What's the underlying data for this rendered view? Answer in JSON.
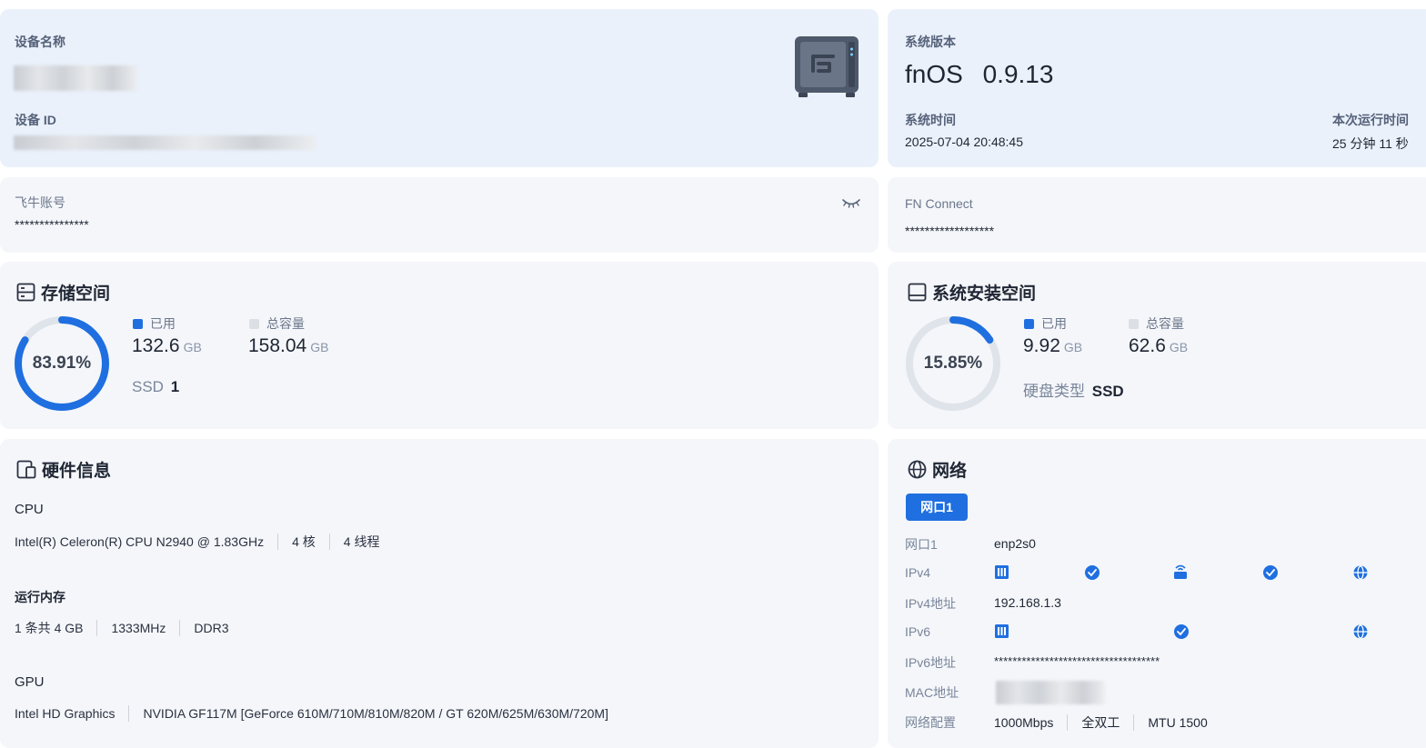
{
  "device": {
    "name_label": "设备名称",
    "id_label": "设备 ID"
  },
  "system": {
    "version_label": "系统版本",
    "version_name": "fnOS",
    "version_number": "0.9.13",
    "time_label": "系统时间",
    "time_value": "2025-07-04 20:48:45",
    "uptime_label": "本次运行时间",
    "uptime_value": "25 分钟 11 秒"
  },
  "account": {
    "label": "飞牛账号",
    "value": "***************"
  },
  "fn_connect": {
    "label": "FN Connect",
    "value": "******************"
  },
  "storage": {
    "title": "存储空间",
    "percent": "83.91%",
    "fraction": 0.8391,
    "used_label": "已用",
    "used_value": "132.6",
    "used_unit": "GB",
    "total_label": "总容量",
    "total_value": "158.04",
    "total_unit": "GB",
    "ssd_label": "SSD",
    "ssd_count": "1"
  },
  "sys_storage": {
    "title": "系统安装空间",
    "percent": "15.85%",
    "fraction": 0.1585,
    "used_label": "已用",
    "used_value": "9.92",
    "used_unit": "GB",
    "total_label": "总容量",
    "total_value": "62.6",
    "total_unit": "GB",
    "disk_type_label": "硬盘类型",
    "disk_type_value": "SSD"
  },
  "hardware": {
    "title": "硬件信息",
    "cpu_label": "CPU",
    "cpu_model": "Intel(R) Celeron(R) CPU N2940 @ 1.83GHz",
    "cpu_cores": "4 核",
    "cpu_threads": "4 线程",
    "mem_label": "运行内存",
    "mem_modules": "1 条共 4 GB",
    "mem_speed": "1333MHz",
    "mem_type": "DDR3",
    "gpu_label": "GPU",
    "gpu_1": "Intel HD Graphics",
    "gpu_2": "NVIDIA GF117M [GeForce 610M/710M/810M/820M / GT 620M/625M/630M/720M]"
  },
  "network": {
    "title": "网络",
    "tab_label": "网口1",
    "port_label": "网口1",
    "port_value": "enp2s0",
    "ipv4_label": "IPv4",
    "ipv4_addr_label": "IPv4地址",
    "ipv4_addr_value": "192.168.1.3",
    "ipv6_label": "IPv6",
    "ipv6_addr_label": "IPv6地址",
    "ipv6_addr_value": "************************************",
    "mac_label": "MAC地址",
    "config_label": "网络配置",
    "config_speed": "1000Mbps",
    "config_duplex": "全双工",
    "config_mtu": "MTU 1500"
  },
  "colors": {
    "accent": "#1f6fe0",
    "card_bg": "#f4f6fa",
    "card_bg_blue": "#eaf1fb",
    "track": "#dfe3ea"
  }
}
